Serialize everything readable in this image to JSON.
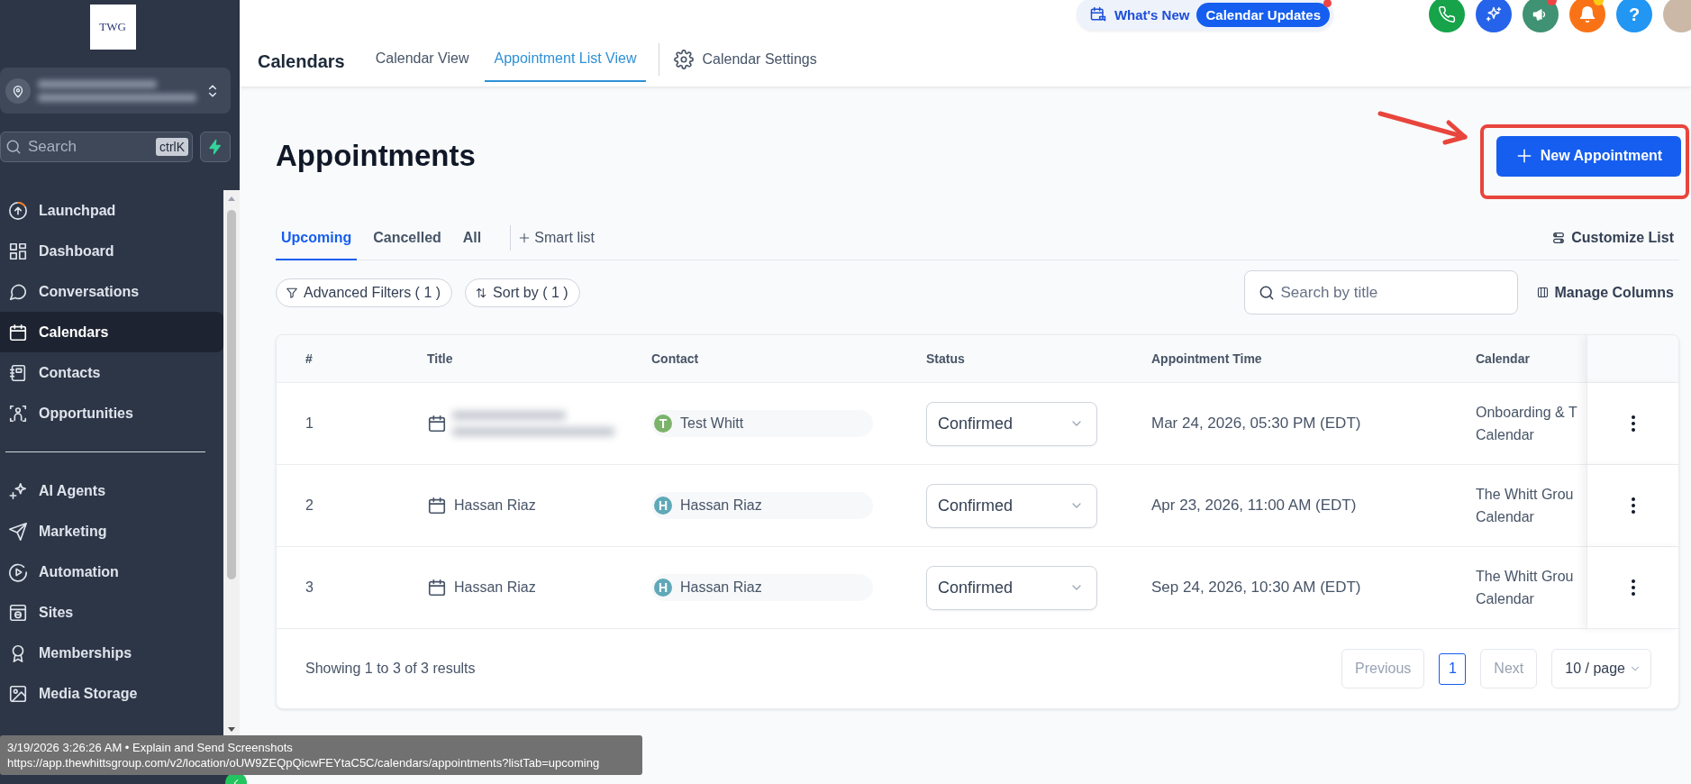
{
  "sidebar": {
    "logo": "TWG",
    "account": {
      "name_redacted": true
    },
    "search": {
      "placeholder": "Search",
      "shortcut": "ctrlK"
    },
    "nav_groups": [
      [
        {
          "label": "Launchpad",
          "selected": false
        },
        {
          "label": "Dashboard",
          "selected": false
        },
        {
          "label": "Conversations",
          "selected": false
        },
        {
          "label": "Calendars",
          "selected": true
        },
        {
          "label": "Contacts",
          "selected": false
        },
        {
          "label": "Opportunities",
          "selected": false
        }
      ],
      [
        {
          "label": "AI Agents",
          "selected": false
        },
        {
          "label": "Marketing",
          "selected": false
        },
        {
          "label": "Automation",
          "selected": false
        },
        {
          "label": "Sites",
          "selected": false
        },
        {
          "label": "Memberships",
          "selected": false
        },
        {
          "label": "Media Storage",
          "selected": false
        }
      ]
    ]
  },
  "header": {
    "whats_new": {
      "label": "What's New",
      "badge": "Calendar Updates",
      "dot": true
    },
    "top_icons": [
      {
        "kind": "phone",
        "color": "#16a34a"
      },
      {
        "kind": "sparkle",
        "color": "#2563eb"
      },
      {
        "kind": "megaphone",
        "color": "#3f9274",
        "badge": {
          "color": "#ef4444"
        }
      },
      {
        "kind": "bell",
        "color": "#f97316",
        "badge": {
          "color": "#facc15"
        }
      },
      {
        "kind": "help",
        "color": "#2196f3",
        "text": "?"
      },
      {
        "kind": "avatar",
        "color": "#cbb8a6"
      }
    ],
    "title": "Calendars",
    "tabs": [
      {
        "label": "Calendar View",
        "selected": false
      },
      {
        "label": "Appointment List View",
        "selected": true
      }
    ],
    "settings_link": "Calendar Settings"
  },
  "page": {
    "heading": "Appointments",
    "new_button": "New Appointment",
    "list_tabs": [
      {
        "label": "Upcoming",
        "selected": true
      },
      {
        "label": "Cancelled",
        "selected": false
      },
      {
        "label": "All",
        "selected": false
      }
    ],
    "smart_list": "Smart list",
    "customize": "Customize List",
    "filters": [
      {
        "kind": "filter",
        "label": "Advanced Filters ( 1 )"
      },
      {
        "kind": "sort",
        "label": "Sort by ( 1 )"
      }
    ],
    "search": {
      "placeholder": "Search by title"
    },
    "manage_columns": "Manage Columns"
  },
  "table": {
    "columns": [
      "#",
      "Title",
      "Contact",
      "Status",
      "Appointment Time",
      "Calendar"
    ],
    "rows": [
      {
        "number": "1",
        "title_redacted": true,
        "contact": {
          "initial": "T",
          "name": "Test Whitt",
          "color": "#7cb36b"
        },
        "status": "Confirmed",
        "time": "Mar 24, 2026, 05:30 PM (EDT)",
        "calendar": [
          "Onboarding & T",
          "Calendar"
        ]
      },
      {
        "number": "2",
        "title_redacted": false,
        "title": "Hassan Riaz",
        "contact": {
          "initial": "H",
          "name": "Hassan Riaz",
          "color": "#5fa8b8"
        },
        "status": "Confirmed",
        "time": "Apr 23, 2026, 11:00 AM (EDT)",
        "calendar": [
          "The Whitt Grou",
          "Calendar"
        ]
      },
      {
        "number": "3",
        "title_redacted": false,
        "title": "Hassan Riaz",
        "contact": {
          "initial": "H",
          "name": "Hassan Riaz",
          "color": "#5fa8b8"
        },
        "status": "Confirmed",
        "time": "Sep 24, 2026, 10:30 AM (EDT)",
        "calendar": [
          "The Whitt Grou",
          "Calendar"
        ]
      }
    ],
    "summary": "Showing 1 to 3 of 3 results",
    "pagination": {
      "previous": {
        "label": "Previous",
        "disabled": true
      },
      "pages": [
        {
          "label": "1",
          "selected": true
        }
      ],
      "next": {
        "label": "Next",
        "disabled": true
      },
      "page_size": "10 / page"
    }
  },
  "annotations": {
    "arrow": true,
    "highlight_box": true
  },
  "tooltip": {
    "lines": [
      "3/19/2026 3:26:26 AM • Explain and Send Screenshots",
      "https://app.thewhittsgroup.com/v2/location/oUW9ZEQpQicwFEYtaC5C/calendars/appointments?listTab=upcoming"
    ]
  }
}
